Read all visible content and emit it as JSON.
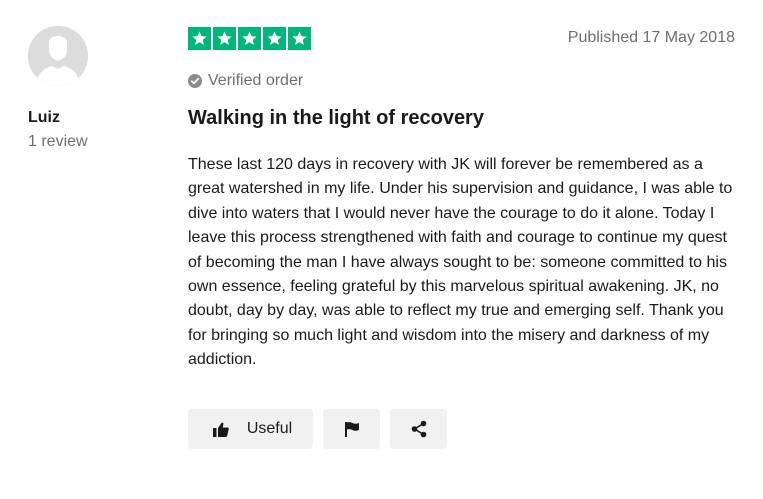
{
  "reviewer": {
    "name": "Luiz",
    "review_count": "1 review",
    "avatar_icon": "user-silhouette-icon"
  },
  "review": {
    "rating": 5,
    "rating_max": 5,
    "star_color": "#00b67a",
    "published": "Published 17 May 2018",
    "verified_label": "Verified order",
    "title": "Walking in the light of recovery",
    "body": "These last 120 days in recovery with JK will forever be remembered as a great watershed in my life. Under his supervision and guidance, I was able to dive into waters that I would never have the courage to do it alone. Today I leave this process strengthened with faith and courage to continue my quest of becoming the man I have always sought to be: someone committed to his own essence, feeling grateful by this marvelous spiritual awakening. JK, no doubt, day by day, was able to reflect my true and emerging self. Thank you for bringing so much light and wisdom into the misery and darkness of my addiction."
  },
  "actions": {
    "useful_label": "Useful",
    "useful_icon": "thumbs-up-icon",
    "flag_icon": "flag-icon",
    "share_icon": "share-icon"
  }
}
